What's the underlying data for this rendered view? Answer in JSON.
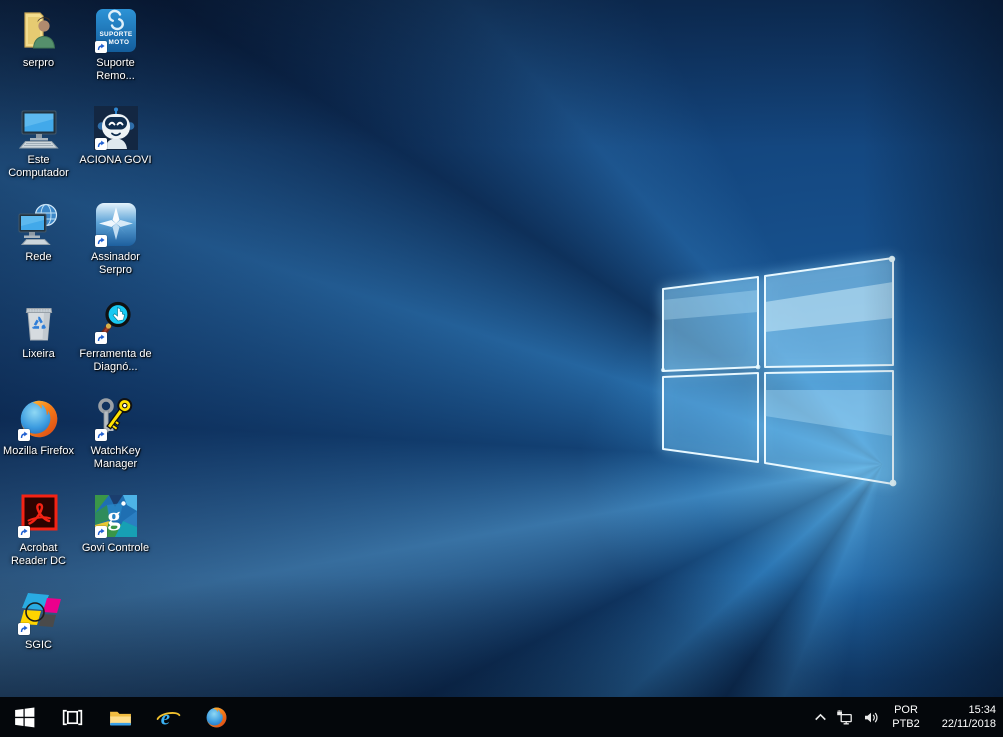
{
  "desktop": {
    "icons": [
      {
        "label": "serpro"
      },
      {
        "label": "Este Computador"
      },
      {
        "label": "Rede"
      },
      {
        "label": "Lixeira"
      },
      {
        "label": "Mozilla Firefox"
      },
      {
        "label": "Acrobat Reader DC"
      },
      {
        "label": "SGIC"
      },
      {
        "label": "Suporte Remo..."
      },
      {
        "label": "ACIONA GOVI"
      },
      {
        "label": "Assinador Serpro"
      },
      {
        "label": "Ferramenta de Diagnó..."
      },
      {
        "label": "WatchKey Manager"
      },
      {
        "label": "Govi Controle"
      }
    ],
    "icon_text": {
      "suporte_line1": "SUPORTE",
      "suporte_line2": "MOTO",
      "govi_letter": "g"
    }
  },
  "taskbar": {
    "icon_text": {
      "ie_letter": "e"
    },
    "tray": {
      "language_top": "POR",
      "language_bottom": "PTB2",
      "time": "15:34",
      "date": "22/11/2018"
    }
  },
  "colors": {
    "wallpaper_base": "#0a2248",
    "wallpaper_accent": "#2e9be6",
    "taskbar_bg": "#04070b",
    "label_text": "#ffffff"
  }
}
